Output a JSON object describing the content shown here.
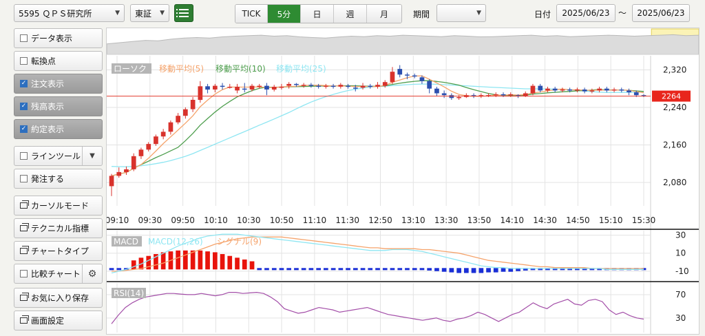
{
  "toolbar": {
    "symbol": "5595 ＱＰＳ研究所",
    "market": "東証",
    "timeframes": [
      "TICK",
      "5分",
      "日",
      "週",
      "月"
    ],
    "active_timeframe": "5分",
    "period_label": "期間",
    "period_value": "",
    "date_label": "日付",
    "date_from": "2025/06/23",
    "date_sep": "〜",
    "date_to": "2025/06/23"
  },
  "sidebar": {
    "items": [
      {
        "label": "データ表示",
        "type": "checkbox",
        "checked": false
      },
      {
        "label": "転換点",
        "type": "checkbox",
        "checked": false
      },
      {
        "label": "注文表示",
        "type": "checkbox",
        "checked": true
      },
      {
        "label": "残高表示",
        "type": "checkbox",
        "checked": true
      },
      {
        "label": "約定表示",
        "type": "checkbox",
        "checked": true
      },
      {
        "label": "ラインツール",
        "type": "checkbox-dropdown",
        "checked": false
      },
      {
        "label": "発注する",
        "type": "checkbox",
        "checked": false
      },
      {
        "label": "カーソルモード",
        "type": "window"
      },
      {
        "label": "テクニカル指標",
        "type": "window"
      },
      {
        "label": "チャートタイプ",
        "type": "window"
      },
      {
        "label": "比較チャート",
        "type": "checkbox-gear",
        "checked": false
      },
      {
        "label": "お気に入り保存",
        "type": "window"
      },
      {
        "label": "画面設定",
        "type": "window"
      }
    ]
  },
  "chart_data": {
    "type": "candlestick",
    "legend": [
      "ローソク",
      "移動平均(5)",
      "移動平均(10)",
      "移動平均(25)"
    ],
    "colors": {
      "up": "#d8322c",
      "down": "#2b4fae",
      "ma5": "#f5a36b",
      "ma10": "#4d9e4d",
      "ma25": "#8ee6f2",
      "price_line": "#e23b2e"
    },
    "y_ticks": [
      2080,
      2160,
      2240,
      2320
    ],
    "ylim": [
      2030,
      2350
    ],
    "current_price": 2264,
    "x_ticks": [
      "09:10",
      "09:30",
      "09:50",
      "10:10",
      "10:30",
      "10:50",
      "11:10",
      "11:30",
      "12:50",
      "13:10",
      "13:30",
      "13:50",
      "14:10",
      "14:30",
      "14:50",
      "15:10",
      "15:30"
    ],
    "candles": [
      [
        2072,
        2094,
        2051,
        2098
      ],
      [
        2094,
        2102,
        2090,
        2112
      ],
      [
        2102,
        2108,
        2096,
        2114
      ],
      [
        2108,
        2136,
        2104,
        2142
      ],
      [
        2136,
        2150,
        2130,
        2154
      ],
      [
        2150,
        2162,
        2146,
        2166
      ],
      [
        2162,
        2178,
        2158,
        2182
      ],
      [
        2178,
        2188,
        2172,
        2194
      ],
      [
        2188,
        2208,
        2182,
        2212
      ],
      [
        2208,
        2222,
        2204,
        2228
      ],
      [
        2222,
        2236,
        2216,
        2240
      ],
      [
        2236,
        2256,
        2230,
        2262
      ],
      [
        2256,
        2285,
        2250,
        2296
      ],
      [
        2285,
        2278,
        2270,
        2290
      ],
      [
        2278,
        2286,
        2272,
        2290
      ],
      [
        2286,
        2284,
        2278,
        2292
      ],
      [
        2284,
        2284,
        2280,
        2290
      ],
      [
        2276,
        2284,
        2270,
        2290
      ],
      [
        2280,
        2278,
        2272,
        2292
      ],
      [
        2278,
        2286,
        2274,
        2290
      ],
      [
        2284,
        2286,
        2280,
        2290
      ],
      [
        2286,
        2278,
        2266,
        2292
      ],
      [
        2278,
        2284,
        2274,
        2288
      ],
      [
        2282,
        2284,
        2278,
        2290
      ],
      [
        2286,
        2290,
        2280,
        2294
      ],
      [
        2290,
        2288,
        2284,
        2292
      ],
      [
        2286,
        2288,
        2282,
        2292
      ],
      [
        2288,
        2286,
        2282,
        2292
      ],
      [
        2286,
        2284,
        2280,
        2290
      ],
      [
        2284,
        2286,
        2280,
        2290
      ],
      [
        2286,
        2284,
        2280,
        2290
      ],
      [
        2284,
        2288,
        2280,
        2292
      ],
      [
        2286,
        2284,
        2280,
        2290
      ],
      [
        2282,
        2280,
        2274,
        2288
      ],
      [
        2282,
        2286,
        2278,
        2292
      ],
      [
        2286,
        2284,
        2280,
        2290
      ],
      [
        2284,
        2288,
        2280,
        2294
      ],
      [
        2286,
        2294,
        2282,
        2298
      ],
      [
        2294,
        2316,
        2290,
        2326
      ],
      [
        2322,
        2310,
        2304,
        2330
      ],
      [
        2310,
        2308,
        2300,
        2314
      ],
      [
        2308,
        2306,
        2302,
        2312
      ],
      [
        2304,
        2296,
        2290,
        2308
      ],
      [
        2296,
        2280,
        2270,
        2300
      ],
      [
        2280,
        2270,
        2264,
        2284
      ],
      [
        2270,
        2266,
        2260,
        2276
      ],
      [
        2266,
        2260,
        2256,
        2270
      ],
      [
        2260,
        2262,
        2256,
        2266
      ],
      [
        2262,
        2266,
        2260,
        2270
      ],
      [
        2266,
        2264,
        2260,
        2270
      ],
      [
        2264,
        2266,
        2260,
        2270
      ],
      [
        2264,
        2266,
        2262,
        2270
      ],
      [
        2266,
        2268,
        2262,
        2272
      ],
      [
        2268,
        2266,
        2262,
        2272
      ],
      [
        2266,
        2268,
        2262,
        2272
      ],
      [
        2266,
        2264,
        2260,
        2268
      ],
      [
        2264,
        2270,
        2262,
        2274
      ],
      [
        2270,
        2286,
        2266,
        2290
      ],
      [
        2286,
        2276,
        2272,
        2290
      ],
      [
        2276,
        2280,
        2272,
        2284
      ],
      [
        2280,
        2276,
        2272,
        2284
      ],
      [
        2276,
        2278,
        2272,
        2282
      ],
      [
        2278,
        2276,
        2272,
        2282
      ],
      [
        2276,
        2278,
        2272,
        2282
      ],
      [
        2278,
        2274,
        2270,
        2282
      ],
      [
        2274,
        2276,
        2270,
        2280
      ],
      [
        2276,
        2280,
        2272,
        2284
      ],
      [
        2280,
        2276,
        2272,
        2284
      ],
      [
        2276,
        2278,
        2272,
        2282
      ],
      [
        2278,
        2276,
        2272,
        2282
      ],
      [
        2276,
        2272,
        2266,
        2280
      ],
      [
        2272,
        2266,
        2262,
        2276
      ],
      [
        2266,
        2264,
        2262,
        2268
      ]
    ],
    "overview_line": [
      0.55,
      0.5,
      0.45,
      0.4,
      0.42,
      0.35,
      0.3,
      0.28,
      0.3,
      0.25,
      0.22,
      0.2,
      0.18,
      0.22,
      0.2,
      0.25,
      0.28,
      0.3,
      0.26,
      0.22,
      0.24,
      0.2,
      0.22,
      0.18,
      0.2,
      0.22,
      0.24,
      0.2,
      0.22,
      0.25,
      0.24,
      0.22,
      0.2,
      0.18,
      0.22,
      0.2,
      0.24,
      0.22,
      0.2,
      0.18,
      0.2,
      0.22,
      0.2,
      0.18,
      0.16,
      0.2,
      0.18
    ],
    "overview_range": [
      0.92,
      1.0
    ],
    "macd": {
      "legend": [
        "MACD",
        "MACD(12,26)",
        "シグナル(9)"
      ],
      "y_ticks": [
        30,
        10,
        -10
      ],
      "ylim": [
        -20,
        35
      ],
      "macd_color": "#8ee6f2",
      "signal_color": "#f5a36b",
      "macd": [
        -12,
        -10,
        -8,
        -5,
        -2,
        2,
        6,
        10,
        14,
        18,
        21,
        24,
        27,
        29,
        30,
        31,
        31,
        31,
        30,
        29,
        28,
        27,
        26,
        25,
        24,
        23,
        22,
        21,
        20,
        19,
        18,
        17,
        16,
        15,
        14,
        13,
        13,
        13,
        14,
        14,
        14,
        13,
        12,
        10,
        8,
        6,
        4,
        2,
        0,
        -2,
        -4,
        -5,
        -6,
        -6,
        -7,
        -7,
        -7,
        -7,
        -7,
        -7,
        -7,
        -7,
        -7,
        -7,
        -7,
        -7,
        -7,
        -8,
        -8,
        -8,
        -8,
        -8,
        -8
      ],
      "signal": [
        -10,
        -10,
        -9,
        -8,
        -7,
        -5,
        -3,
        -1,
        2,
        5,
        8,
        11,
        14,
        17,
        20,
        22,
        24,
        26,
        27,
        28,
        28,
        28,
        28,
        28,
        27,
        26,
        25,
        24,
        23,
        22,
        21,
        20,
        19,
        18,
        17,
        16,
        16,
        15,
        15,
        15,
        15,
        15,
        14,
        14,
        13,
        12,
        11,
        10,
        8,
        6,
        4,
        2,
        1,
        0,
        -1,
        -2,
        -3,
        -4,
        -5,
        -5,
        -6,
        -6,
        -6,
        -6,
        -6,
        -7,
        -7,
        -7,
        -7,
        -7,
        -7,
        -7,
        -7
      ],
      "hist": [
        -2,
        -1,
        -1,
        2,
        5,
        7,
        9,
        11,
        12,
        13,
        13,
        13,
        13,
        12,
        11,
        9,
        7,
        5,
        3,
        1,
        0,
        -1,
        -2,
        -3,
        -3,
        -3,
        -3,
        -3,
        -3,
        -3,
        -3,
        -3,
        -3,
        -3,
        -3,
        -3,
        -3,
        -2,
        -1,
        -1,
        -1,
        -2,
        -2,
        -4,
        -5,
        -6,
        -7,
        -8,
        -8,
        -8,
        -8,
        -7,
        -7,
        -6,
        -6,
        -5,
        -4,
        -3,
        -2,
        -2,
        -1,
        -1,
        -1,
        -1,
        -1,
        -1,
        -1,
        -1,
        -1,
        -1,
        -1,
        -1,
        -1
      ]
    },
    "rsi": {
      "legend": "RSI(14)",
      "y_ticks": [
        70,
        30
      ],
      "ylim": [
        5,
        90
      ],
      "color": "#a34ea8",
      "values": [
        20,
        35,
        48,
        56,
        62,
        66,
        68,
        70,
        72,
        72,
        71,
        70,
        70,
        72,
        70,
        68,
        70,
        74,
        74,
        72,
        73,
        74,
        72,
        66,
        58,
        46,
        42,
        38,
        40,
        44,
        48,
        46,
        44,
        40,
        42,
        44,
        46,
        48,
        44,
        40,
        36,
        34,
        32,
        30,
        28,
        26,
        28,
        30,
        26,
        24,
        28,
        30,
        34,
        40,
        36,
        30,
        24,
        30,
        36,
        40,
        48,
        56,
        50,
        46,
        54,
        58,
        62,
        54,
        52,
        60,
        62,
        58,
        44,
        36,
        40,
        34,
        30,
        28
      ]
    }
  }
}
